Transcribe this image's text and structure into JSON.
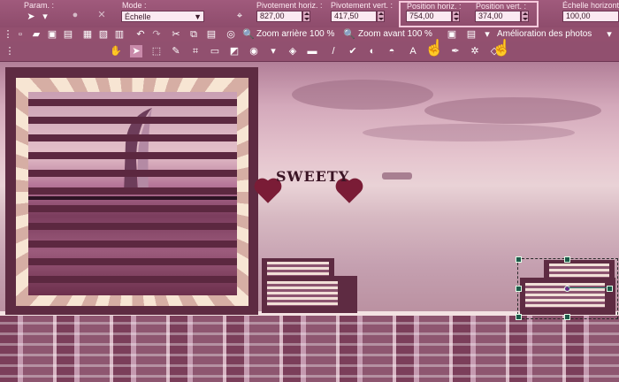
{
  "optionsbar": {
    "param_label": "Param. :",
    "mode_label": "Mode :",
    "mode_value": "Échelle",
    "pivot_h_label": "Pivotement horiz. :",
    "pivot_h_value": "827,00",
    "pivot_v_label": "Pivotement vert. :",
    "pivot_v_value": "417,50",
    "pos_h_label": "Position horiz. :",
    "pos_h_value": "754,00",
    "pos_v_label": "Position vert. :",
    "pos_v_value": "374,00",
    "scale_h_label": "Échelle horizont",
    "scale_h_value": "100,00"
  },
  "toolbar": {
    "zoom_out_label": "Zoom arrière 100 %",
    "zoom_in_label": "Zoom avant 100 %",
    "enhance_label": "Amélioration des photos"
  },
  "canvas": {
    "watermark_text": "SWEETY"
  }
}
